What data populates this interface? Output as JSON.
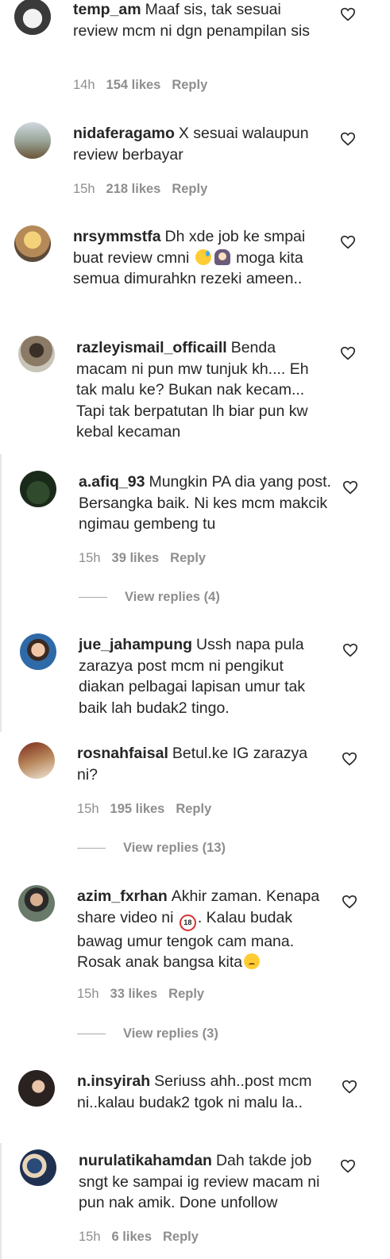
{
  "colors": {
    "text": "#262626",
    "meta": "#8e8e8e",
    "background": "#ffffff"
  },
  "comments": [
    {
      "username": "temp_am",
      "text": "Maaf sis, tak sesuai review mcm ni dgn penampilan sis",
      "time": "14h",
      "likes": "154 likes",
      "reply": "Reply"
    },
    {
      "username": "nidaferagamo",
      "text": "X sesuai walaupun review berbayar",
      "time": "15h",
      "likes": "218 likes",
      "reply": "Reply"
    },
    {
      "username": "nrsymmstfa",
      "text_a": "Dh xde job ke smpai buat review cmni",
      "text_b": "moga kita semua dimurahkn rezeki ameen..",
      "emoji": [
        "sweat-smile-emoji",
        "person-facepalming-emoji"
      ]
    },
    {
      "username": "razleyismail_officaill",
      "text": "Benda macam ni pun mw tunjuk kh.... Eh tak malu ke? Bukan nak kecam... Tapi tak berpatutan lh biar pun kw kebal kecaman"
    },
    {
      "username": "a.afiq_93",
      "text": "Mungkin PA dia yang post. Bersangka baik. Ni kes mcm makcik ngimau gembeng tu",
      "time": "15h",
      "likes": "39 likes",
      "reply": "Reply",
      "view_replies": "View replies (4)"
    },
    {
      "username": "jue_jahampung",
      "text": "Ussh napa pula zarazya post mcm ni pengikut diakan pelbagai lapisan umur tak baik lah budak2 tingo."
    },
    {
      "username": "rosnahfaisal",
      "text": "Betul.ke IG zarazya ni?",
      "time": "15h",
      "likes": "195 likes",
      "reply": "Reply",
      "view_replies": "View replies (13)"
    },
    {
      "username": "azim_fxrhan",
      "text_a": "Akhir zaman. Kenapa share video ni",
      "text_b": ". Kalau budak bawag umur tengok cam mana. Rosak anak bangsa kita",
      "emoji": [
        "no-one-under-18-emoji",
        "sad-face-emoji"
      ],
      "time": "15h",
      "likes": "33 likes",
      "reply": "Reply",
      "view_replies": "View replies (3)"
    },
    {
      "username": "n.insyirah",
      "text": "Seriuss ahh..post mcm ni..kalau budak2 tgok ni malu la.."
    },
    {
      "username": "nurulatikahamdan",
      "text": "Dah takde job sngt ke sampai ig review macam ni pun nak amik. Done unfollow",
      "time": "15h",
      "likes": "6 likes",
      "reply": "Reply"
    }
  ]
}
